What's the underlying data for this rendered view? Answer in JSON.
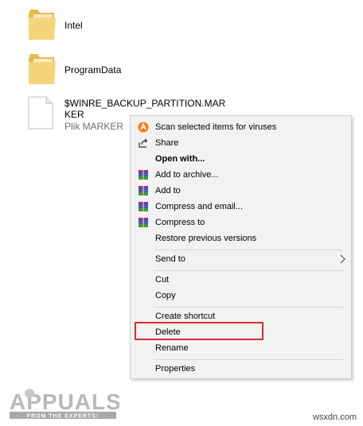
{
  "files": [
    {
      "name": "Intel",
      "type": "folder"
    },
    {
      "name": "ProgramData",
      "type": "folder"
    },
    {
      "name_line1": "$WINRE_BACKUP_PARTITION.MAR",
      "name_line2": "KER",
      "subtitle": "Plik MARKER",
      "type": "file"
    }
  ],
  "context_menu": {
    "items": [
      {
        "label": "Scan selected items for viruses",
        "icon": "avast-icon"
      },
      {
        "label": "Share",
        "icon": "share-icon"
      },
      {
        "label": "Open with...",
        "bold": true
      },
      {
        "label": "Add to archive...",
        "icon": "winrar-icon"
      },
      {
        "label": "Add to",
        "icon": "winrar-icon"
      },
      {
        "label": "Compress and email...",
        "icon": "winrar-icon"
      },
      {
        "label": "Compress to",
        "icon": "winrar-icon"
      },
      {
        "label": "Restore previous versions"
      },
      {
        "label": "Send to",
        "submenu": true
      },
      {
        "label": "Cut"
      },
      {
        "label": "Copy"
      },
      {
        "label": "Create shortcut"
      },
      {
        "label": "Delete",
        "highlighted": true
      },
      {
        "label": "Rename"
      },
      {
        "label": "Properties"
      }
    ]
  },
  "watermark": {
    "brand": "APPUALS",
    "tagline": "FROM THE EXPERTS!"
  },
  "site": "wsxdn.com",
  "colors": {
    "highlight": "#d32f2f",
    "folder": "#f4ce6a",
    "menu_bg": "#f2f2f2"
  }
}
